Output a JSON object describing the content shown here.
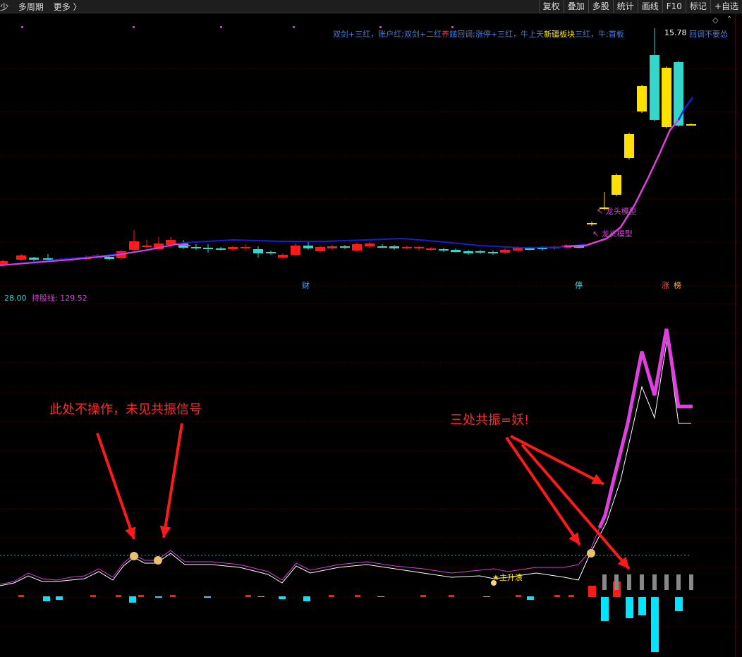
{
  "toolbar": {
    "left": [
      "少",
      "多周期",
      "更多 〉"
    ],
    "right": [
      "复权",
      "叠加",
      "多股",
      "统计",
      "画线",
      "F10",
      "标记",
      "+自选"
    ]
  },
  "legend_top": {
    "part1": "双剑+三红，账户红;双剑+二红",
    "part2": "养",
    "part3": "鎚回调;",
    "part4": "涨停+三红，牛上天",
    "part5": "新疆板块",
    "part6": "三红，牛;",
    "part7": "首板",
    "part8": "回调不要怂"
  },
  "price_tag": "15.78",
  "markers": {
    "dragon1": "龙头模型",
    "dragon2": "龙头模型",
    "cai": "财",
    "ting": "停",
    "zhang": "涨",
    "bang": "榜"
  },
  "lower_legend": {
    "value": "28.00",
    "label": "持股线:",
    "line_value": "129.52"
  },
  "annotations": {
    "left": "此处不操作，未见共振信号",
    "right": "三处共振=妖!",
    "main_rise": "★主升浪"
  },
  "colors": {
    "up": "#ff1a1a",
    "down": "#33d6c8",
    "yellow": "#ffe000",
    "ma_blue": "#1020d8",
    "ma_magenta": "#e040e0",
    "cyan_bar": "#00e5ff",
    "red_bar": "#ff1a1a",
    "grey_bar": "#888888"
  }
}
